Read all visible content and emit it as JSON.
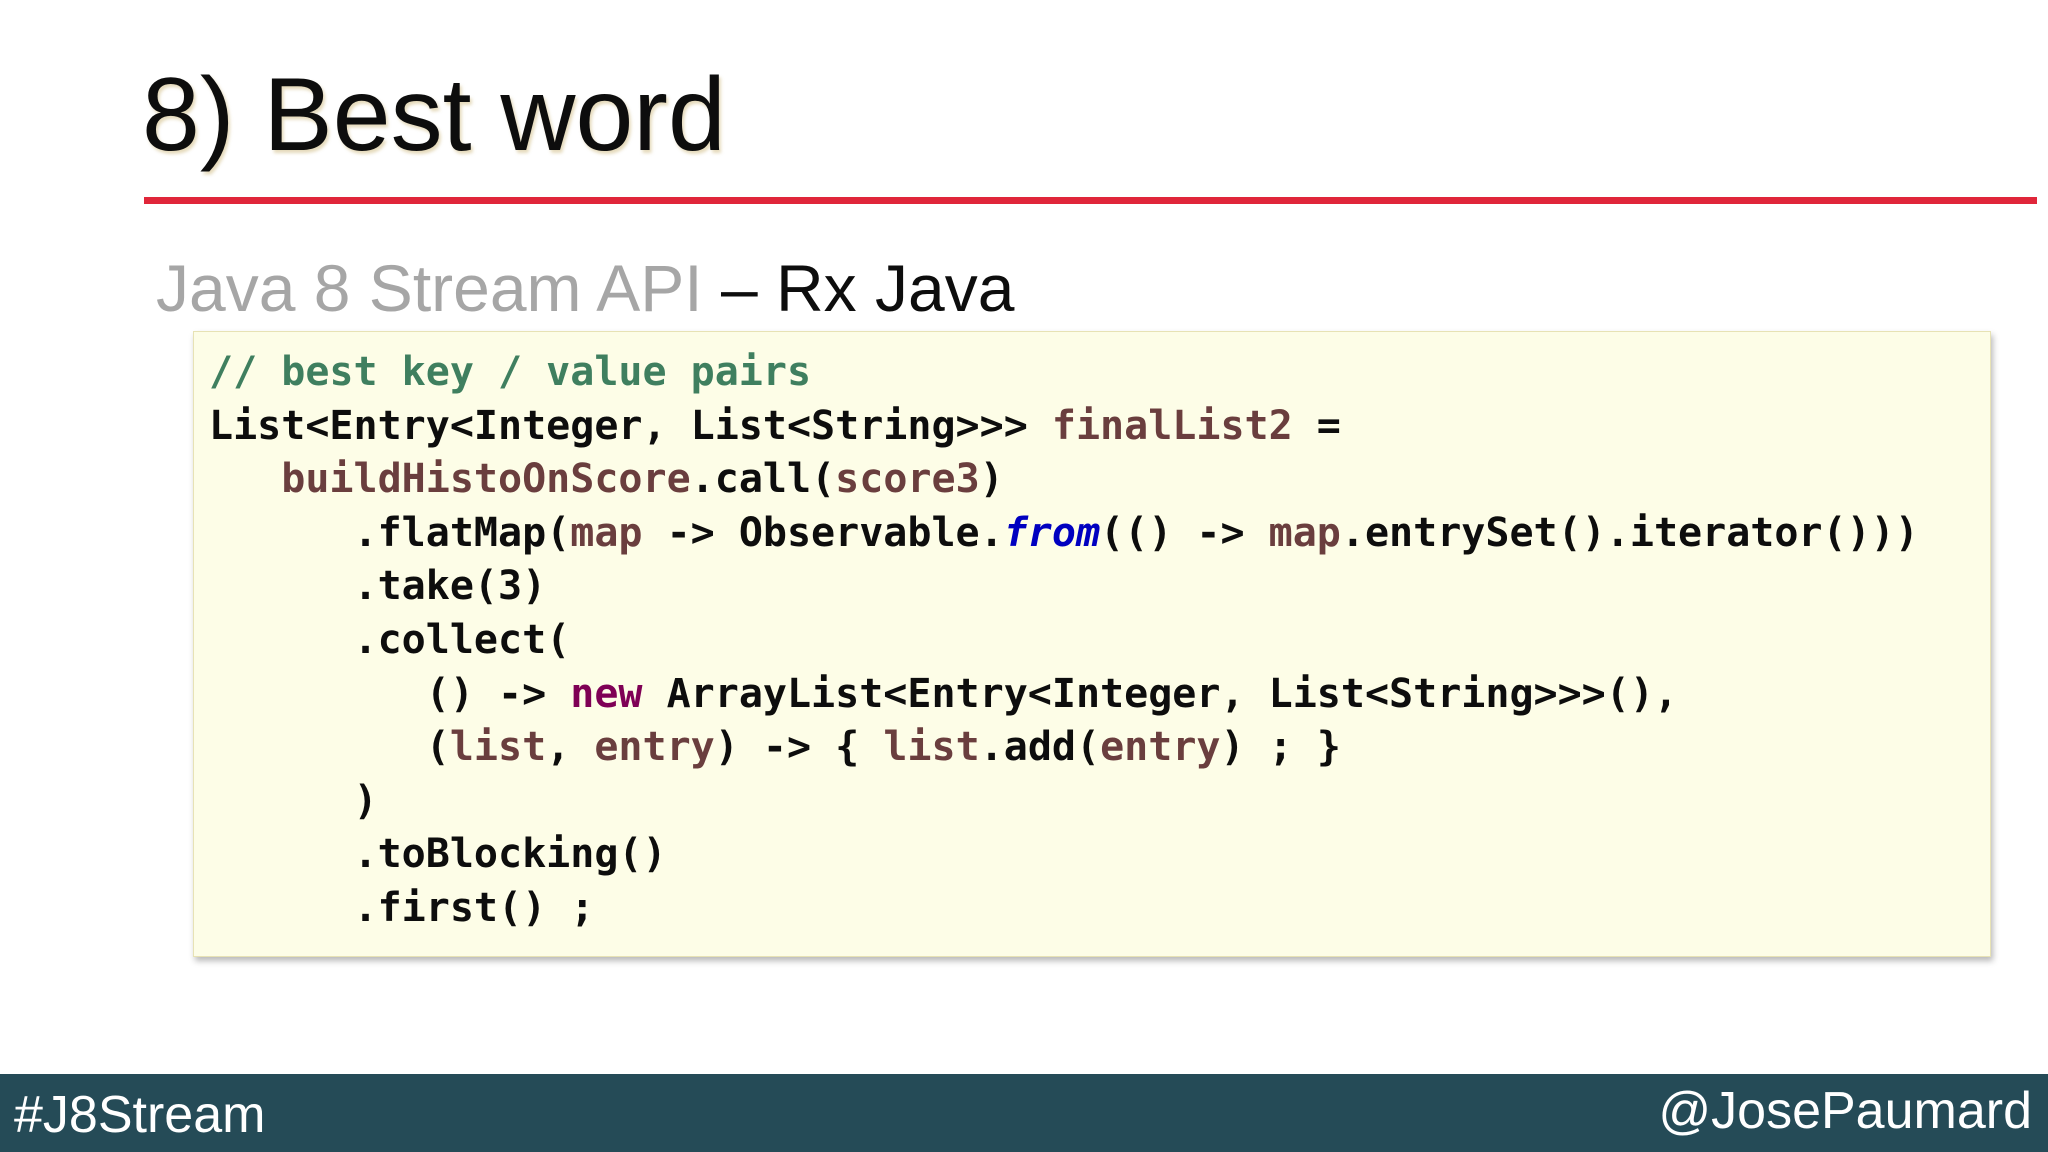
{
  "slide": {
    "title": "8) Best word",
    "subtitle_muted": "Java 8 Stream API",
    "subtitle_strong": " – Rx Java"
  },
  "code_lines": [
    [
      [
        "cmt",
        "// best key / value pairs"
      ]
    ],
    [
      [
        "plain",
        "List<Entry<Integer, List<String>>> "
      ],
      [
        "var",
        "finalList2"
      ],
      [
        "plain",
        " ="
      ]
    ],
    [
      [
        "plain",
        "   "
      ],
      [
        "var",
        "buildHistoOnScore"
      ],
      [
        "plain",
        ".call("
      ],
      [
        "var",
        "score3"
      ],
      [
        "plain",
        ")"
      ]
    ],
    [
      [
        "plain",
        "      .flatMap("
      ],
      [
        "var",
        "map"
      ],
      [
        "plain",
        " -> Observable."
      ],
      [
        "sta",
        "from"
      ],
      [
        "plain",
        "(() -> "
      ],
      [
        "var",
        "map"
      ],
      [
        "plain",
        ".entrySet().iterator()))"
      ]
    ],
    [
      [
        "plain",
        "      .take(3)"
      ]
    ],
    [
      [
        "plain",
        "      .collect("
      ]
    ],
    [
      [
        "plain",
        "         () -> "
      ],
      [
        "kw",
        "new"
      ],
      [
        "plain",
        " ArrayList<Entry<Integer, List<String>>>(),"
      ]
    ],
    [
      [
        "plain",
        "         ("
      ],
      [
        "var",
        "list"
      ],
      [
        "plain",
        ", "
      ],
      [
        "var",
        "entry"
      ],
      [
        "plain",
        ") -> { "
      ],
      [
        "var",
        "list"
      ],
      [
        "plain",
        ".add("
      ],
      [
        "var",
        "entry"
      ],
      [
        "plain",
        ") ; }"
      ]
    ],
    [
      [
        "plain",
        "      )"
      ]
    ],
    [
      [
        "plain",
        "      .toBlocking()"
      ]
    ],
    [
      [
        "plain",
        "      .first() ;"
      ]
    ]
  ],
  "footer": {
    "hashtag": "#J8Stream",
    "handle": "@JosePaumard"
  },
  "colors": {
    "title_rule": "#e0263a",
    "footer_bg": "#254b57",
    "code_bg": "#fdfde7",
    "comment": "#3f7f5f",
    "variable": "#6a3e3e",
    "keyword": "#7f0055",
    "static_method": "#0000c0"
  }
}
